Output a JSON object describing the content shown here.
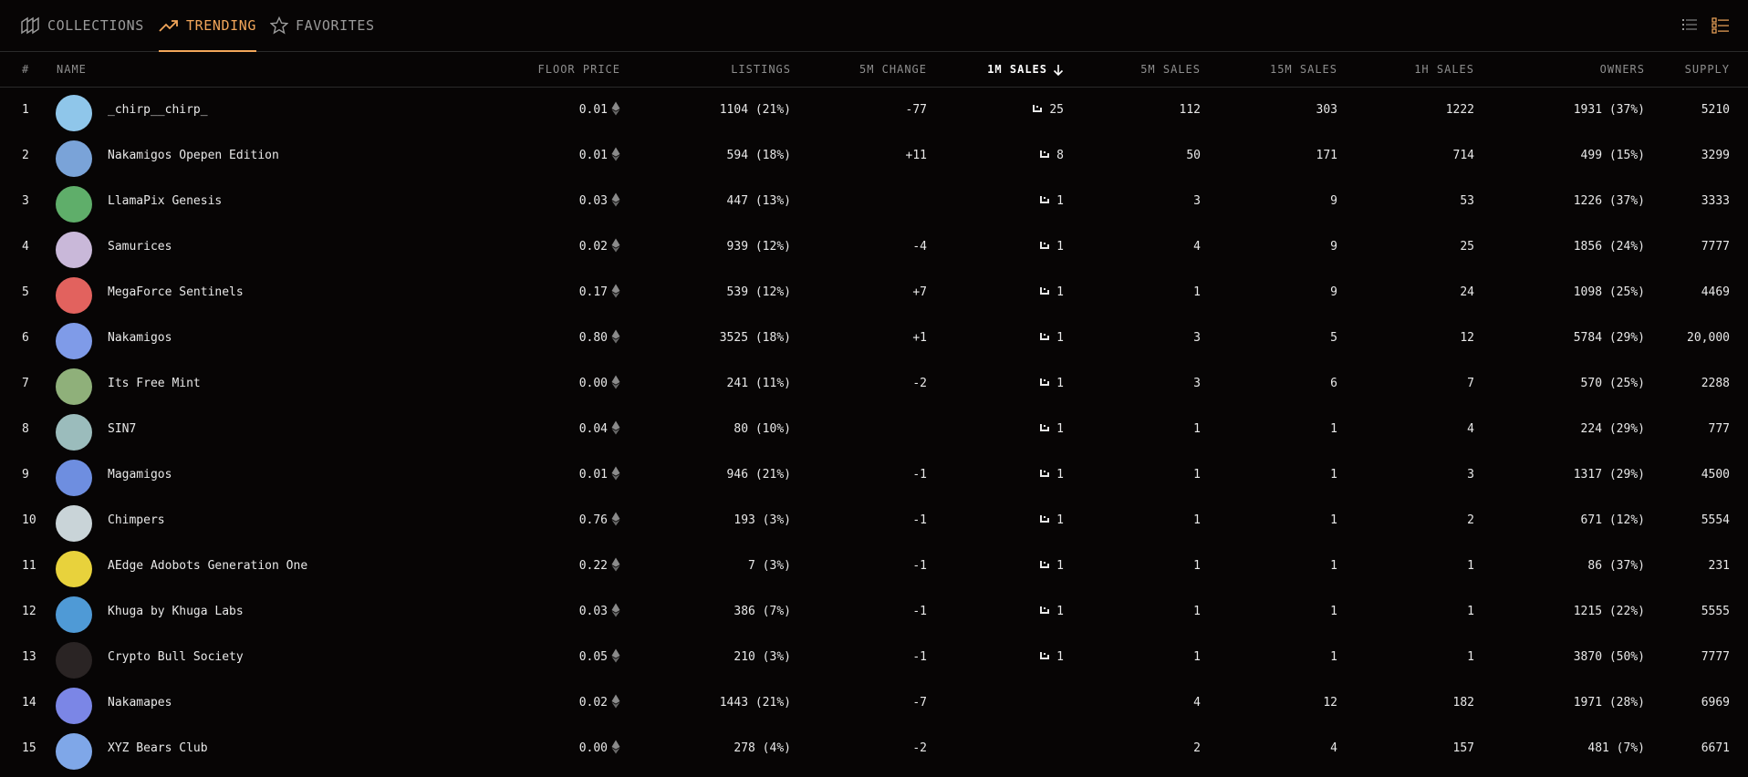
{
  "nav": {
    "tabs": [
      {
        "label": "COLLECTIONS",
        "icon": "collections-icon",
        "active": false
      },
      {
        "label": "TRENDING",
        "icon": "trending-icon",
        "active": true
      },
      {
        "label": "FAVORITES",
        "icon": "star-icon",
        "active": false
      }
    ],
    "accent_color": "#f2a65a"
  },
  "table": {
    "headers": {
      "rank": "#",
      "name": "NAME",
      "floor": "FLOOR PRICE",
      "listings": "LISTINGS",
      "change_5m": "5M CHANGE",
      "sales_1m": "1M SALES",
      "sales_5m": "5M SALES",
      "sales_15m": "15M SALES",
      "sales_1h": "1H SALES",
      "owners": "OWNERS",
      "supply": "SUPPLY"
    },
    "sorted_by": "1M SALES",
    "rows": [
      {
        "rank": "1",
        "name": "_chirp__chirp_",
        "floor": "0.01",
        "listings": "1104 (21%)",
        "change_5m": "-77",
        "sales_1m": "25",
        "sales_5m": "112",
        "sales_15m": "303",
        "sales_1h": "1222",
        "owners": "1931 (37%)",
        "supply": "5210",
        "avatar_color": "#8fc6ea"
      },
      {
        "rank": "2",
        "name": "Nakamigos Opepen Edition",
        "floor": "0.01",
        "listings": "594 (18%)",
        "change_5m": "+11",
        "sales_1m": "8",
        "sales_5m": "50",
        "sales_15m": "171",
        "sales_1h": "714",
        "owners": "499 (15%)",
        "supply": "3299",
        "avatar_color": "#7aa3d8"
      },
      {
        "rank": "3",
        "name": "LlamaPix Genesis",
        "floor": "0.03",
        "listings": "447 (13%)",
        "change_5m": "",
        "sales_1m": "1",
        "sales_5m": "3",
        "sales_15m": "9",
        "sales_1h": "53",
        "owners": "1226 (37%)",
        "supply": "3333",
        "avatar_color": "#5fae6a"
      },
      {
        "rank": "4",
        "name": "Samurices",
        "floor": "0.02",
        "listings": "939 (12%)",
        "change_5m": "-4",
        "sales_1m": "1",
        "sales_5m": "4",
        "sales_15m": "9",
        "sales_1h": "25",
        "owners": "1856 (24%)",
        "supply": "7777",
        "avatar_color": "#c9b8d9"
      },
      {
        "rank": "5",
        "name": "MegaForce Sentinels",
        "floor": "0.17",
        "listings": "539 (12%)",
        "change_5m": "+7",
        "sales_1m": "1",
        "sales_5m": "1",
        "sales_15m": "9",
        "sales_1h": "24",
        "owners": "1098 (25%)",
        "supply": "4469",
        "avatar_color": "#e2625e"
      },
      {
        "rank": "6",
        "name": "Nakamigos",
        "floor": "0.80",
        "listings": "3525 (18%)",
        "change_5m": "+1",
        "sales_1m": "1",
        "sales_5m": "3",
        "sales_15m": "5",
        "sales_1h": "12",
        "owners": "5784 (29%)",
        "supply": "20,000",
        "avatar_color": "#7f9be8"
      },
      {
        "rank": "7",
        "name": "Its Free Mint",
        "floor": "0.00",
        "listings": "241 (11%)",
        "change_5m": "-2",
        "sales_1m": "1",
        "sales_5m": "3",
        "sales_15m": "6",
        "sales_1h": "7",
        "owners": "570 (25%)",
        "supply": "2288",
        "avatar_color": "#8fb07a"
      },
      {
        "rank": "8",
        "name": "SIN7",
        "floor": "0.04",
        "listings": "80 (10%)",
        "change_5m": "",
        "sales_1m": "1",
        "sales_5m": "1",
        "sales_15m": "1",
        "sales_1h": "4",
        "owners": "224 (29%)",
        "supply": "777",
        "avatar_color": "#9bbcbc"
      },
      {
        "rank": "9",
        "name": "Magamigos",
        "floor": "0.01",
        "listings": "946 (21%)",
        "change_5m": "-1",
        "sales_1m": "1",
        "sales_5m": "1",
        "sales_15m": "1",
        "sales_1h": "3",
        "owners": "1317 (29%)",
        "supply": "4500",
        "avatar_color": "#6e8ee0"
      },
      {
        "rank": "10",
        "name": "Chimpers",
        "floor": "0.76",
        "listings": "193 (3%)",
        "change_5m": "-1",
        "sales_1m": "1",
        "sales_5m": "1",
        "sales_15m": "1",
        "sales_1h": "2",
        "owners": "671 (12%)",
        "supply": "5554",
        "avatar_color": "#c9d4d8"
      },
      {
        "rank": "11",
        "name": "AEdge Adobots Generation One",
        "floor": "0.22",
        "listings": "7 (3%)",
        "change_5m": "-1",
        "sales_1m": "1",
        "sales_5m": "1",
        "sales_15m": "1",
        "sales_1h": "1",
        "owners": "86 (37%)",
        "supply": "231",
        "avatar_color": "#e8d23c"
      },
      {
        "rank": "12",
        "name": "Khuga by Khuga Labs",
        "floor": "0.03",
        "listings": "386 (7%)",
        "change_5m": "-1",
        "sales_1m": "1",
        "sales_5m": "1",
        "sales_15m": "1",
        "sales_1h": "1",
        "owners": "1215 (22%)",
        "supply": "5555",
        "avatar_color": "#4f9ad6"
      },
      {
        "rank": "13",
        "name": "Crypto Bull Society",
        "floor": "0.05",
        "listings": "210 (3%)",
        "change_5m": "-1",
        "sales_1m": "1",
        "sales_5m": "1",
        "sales_15m": "1",
        "sales_1h": "1",
        "owners": "3870 (50%)",
        "supply": "7777",
        "avatar_color": "#2a2424"
      },
      {
        "rank": "14",
        "name": "Nakamapes",
        "floor": "0.02",
        "listings": "1443 (21%)",
        "change_5m": "-7",
        "sales_1m": "",
        "sales_5m": "4",
        "sales_15m": "12",
        "sales_1h": "182",
        "owners": "1971 (28%)",
        "supply": "6969",
        "avatar_color": "#7b86e6"
      },
      {
        "rank": "15",
        "name": "XYZ Bears Club",
        "floor": "0.00",
        "listings": "278 (4%)",
        "change_5m": "-2",
        "sales_1m": "",
        "sales_5m": "2",
        "sales_15m": "4",
        "sales_1h": "157",
        "owners": "481 (7%)",
        "supply": "6671",
        "avatar_color": "#7fa7e8"
      }
    ]
  }
}
